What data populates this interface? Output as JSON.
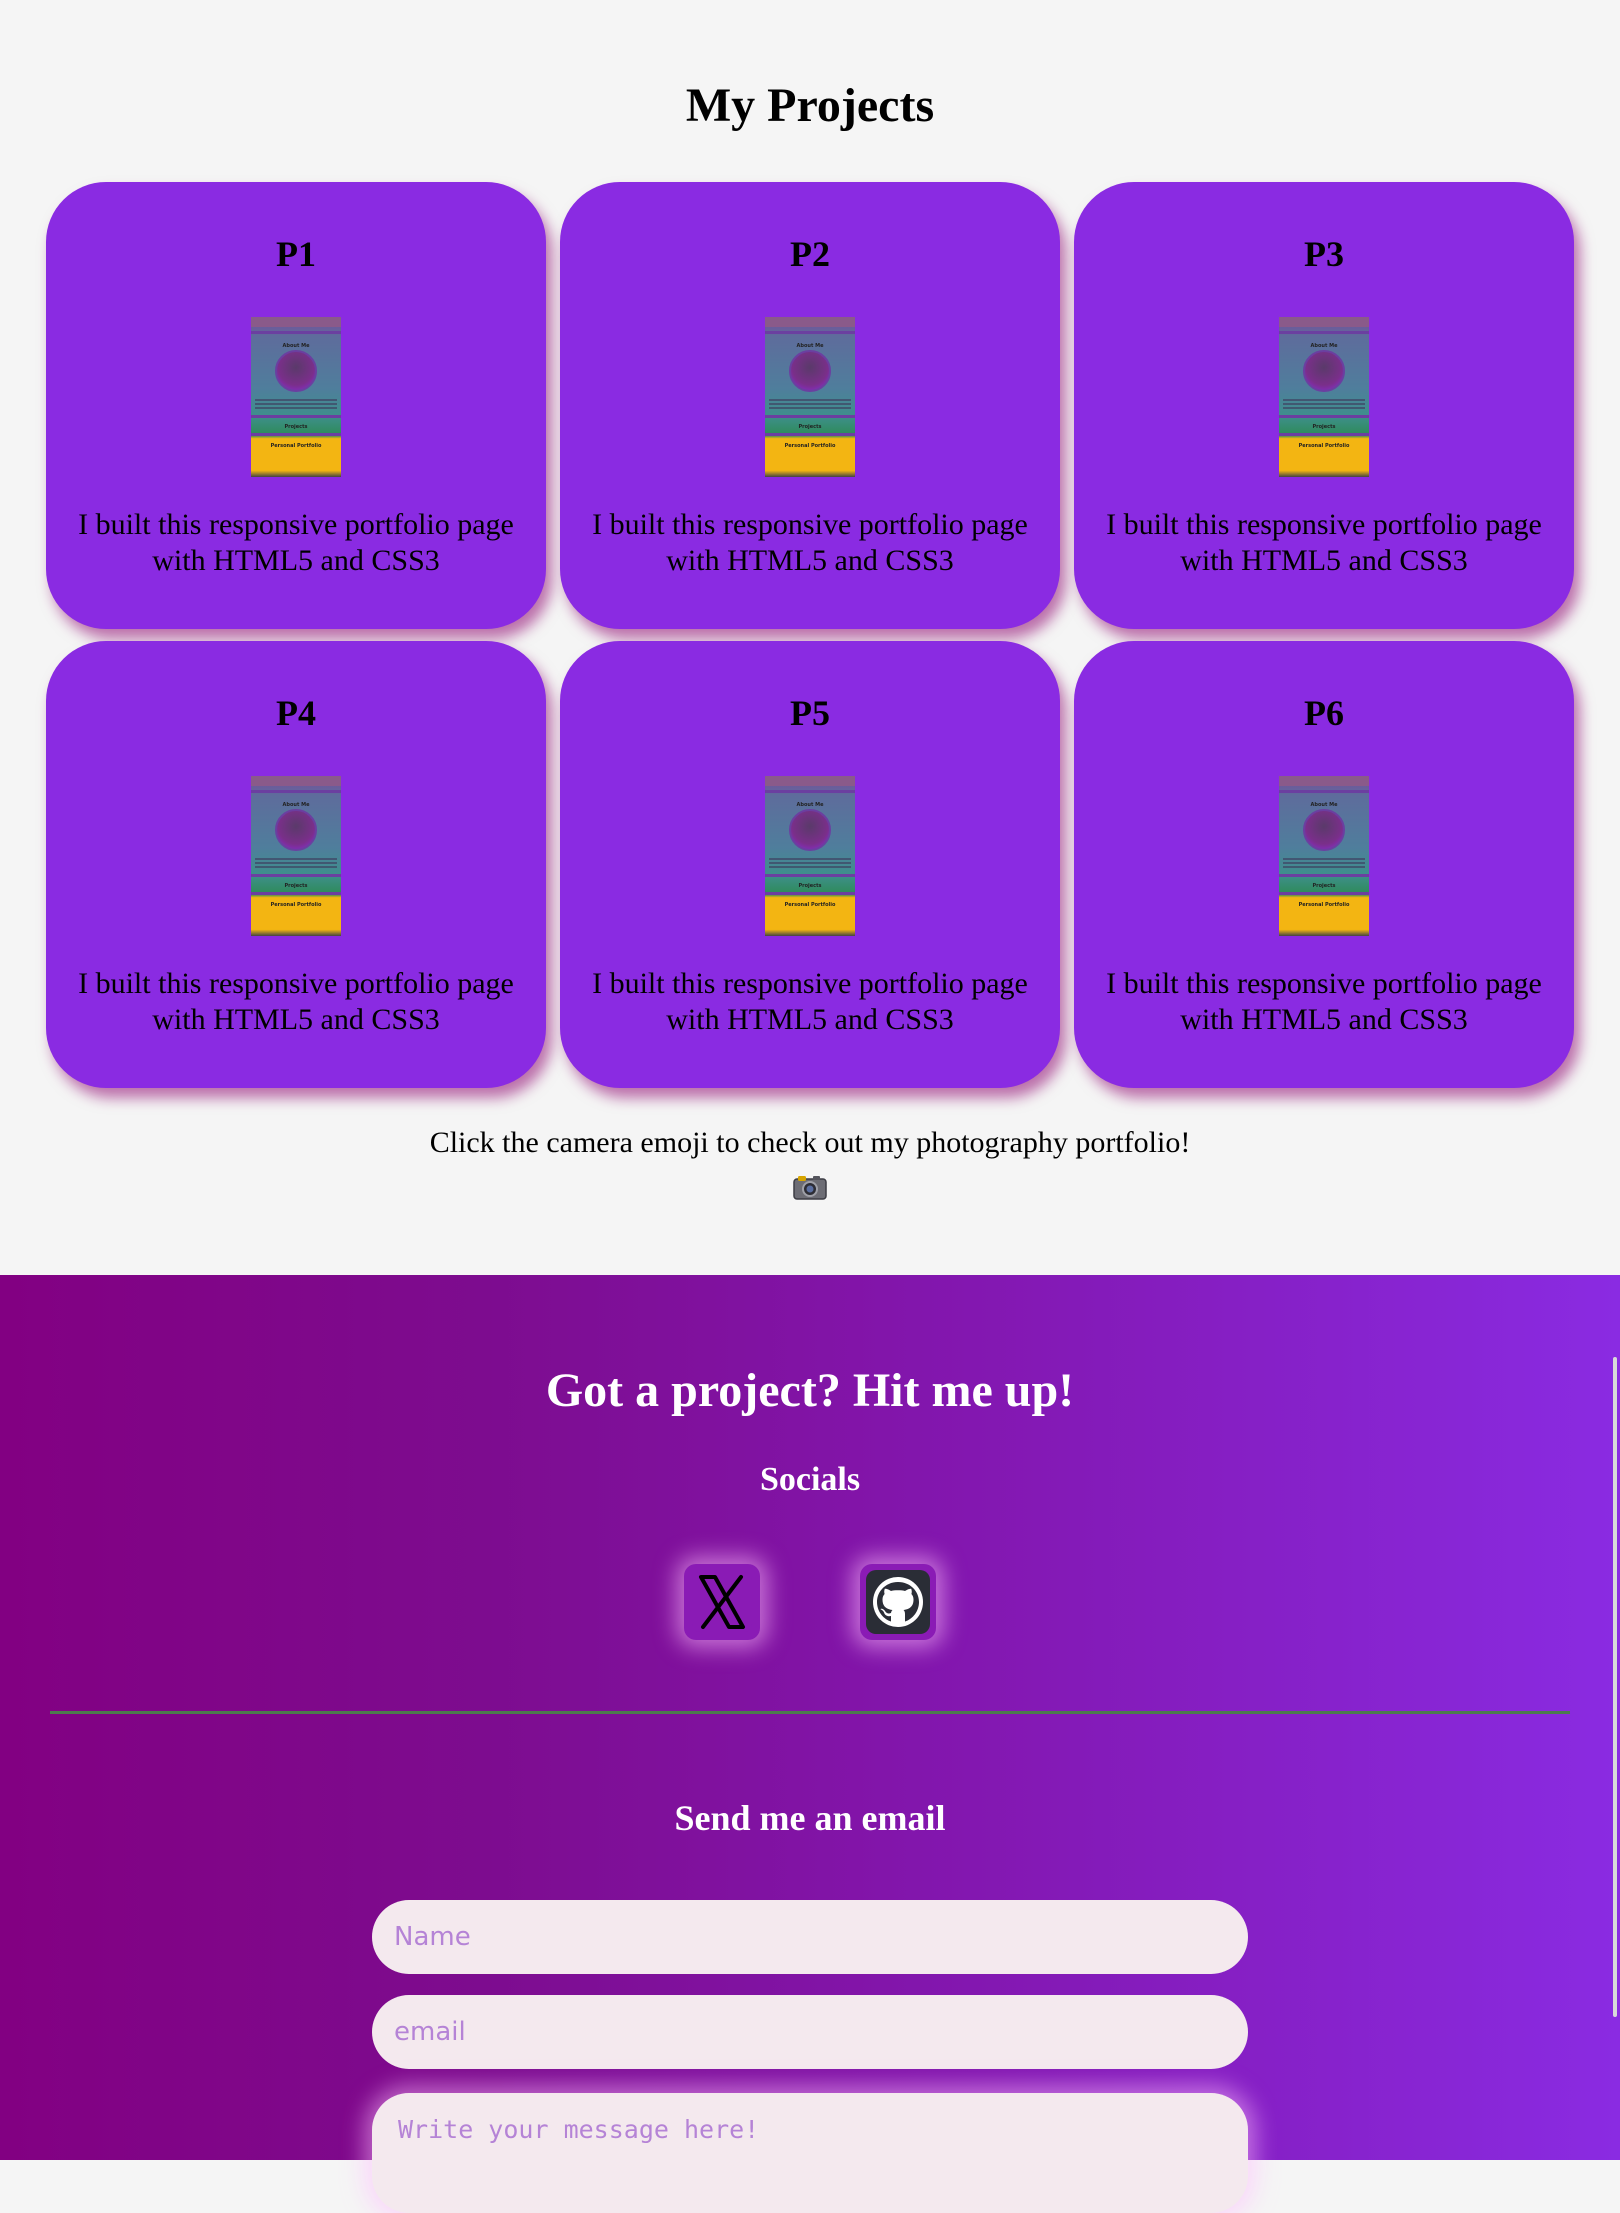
{
  "projects": {
    "title": "My Projects",
    "cards": [
      {
        "title": "P1",
        "description": "I built this responsive portfolio page with HTML5 and CSS3"
      },
      {
        "title": "P2",
        "description": "I built this responsive portfolio page with HTML5 and CSS3"
      },
      {
        "title": "P3",
        "description": "I built this responsive portfolio page with HTML5 and CSS3"
      },
      {
        "title": "P4",
        "description": "I built this responsive portfolio page with HTML5 and CSS3"
      },
      {
        "title": "P5",
        "description": "I built this responsive portfolio page with HTML5 and CSS3"
      },
      {
        "title": "P6",
        "description": "I built this responsive portfolio page with HTML5 and CSS3"
      }
    ],
    "thumbnail": {
      "about_label": "About Me",
      "projects_label": "Projects",
      "portfolio_label": "Personal Portfolio"
    },
    "camera_note": "Click the camera emoji to check out my photography portfolio!",
    "camera_icon": "camera-icon"
  },
  "contact": {
    "title": "Got a project? Hit me up!",
    "socials_title": "Socials",
    "socials": [
      {
        "name": "x-icon"
      },
      {
        "name": "github-icon"
      }
    ],
    "email_title": "Send me an email",
    "form": {
      "name_placeholder": "Name",
      "email_placeholder": "email",
      "message_placeholder": "Write your message here!"
    }
  },
  "colors": {
    "card_bg": "#8a2be2",
    "page_bg": "#f5f5f5",
    "footer_gradient_start": "#820082",
    "footer_gradient_end": "#8a2be2",
    "field_bg": "#f4e9ee",
    "placeholder": "#b583d6"
  }
}
